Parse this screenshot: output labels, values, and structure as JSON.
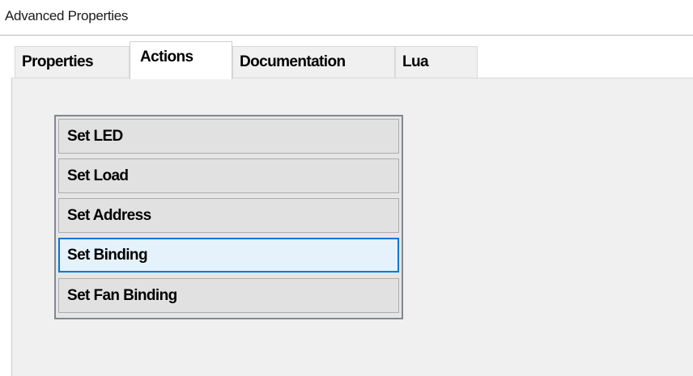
{
  "window": {
    "title": "Advanced Properties"
  },
  "tabs": [
    {
      "label": "Properties",
      "selected": false
    },
    {
      "label": "Actions",
      "selected": true
    },
    {
      "label": "Documentation",
      "selected": false
    },
    {
      "label": "Lua",
      "selected": false
    }
  ],
  "actions": {
    "buttons": [
      {
        "label": "Set LED",
        "focused": false
      },
      {
        "label": "Set Load",
        "focused": false
      },
      {
        "label": "Set Address",
        "focused": false
      },
      {
        "label": "Set Binding",
        "focused": true
      },
      {
        "label": "Set Fan Binding",
        "focused": false
      }
    ]
  },
  "colors": {
    "focus_border": "#0078d7",
    "panel_background": "#f0f0f0",
    "button_background": "#e1e1e1"
  }
}
